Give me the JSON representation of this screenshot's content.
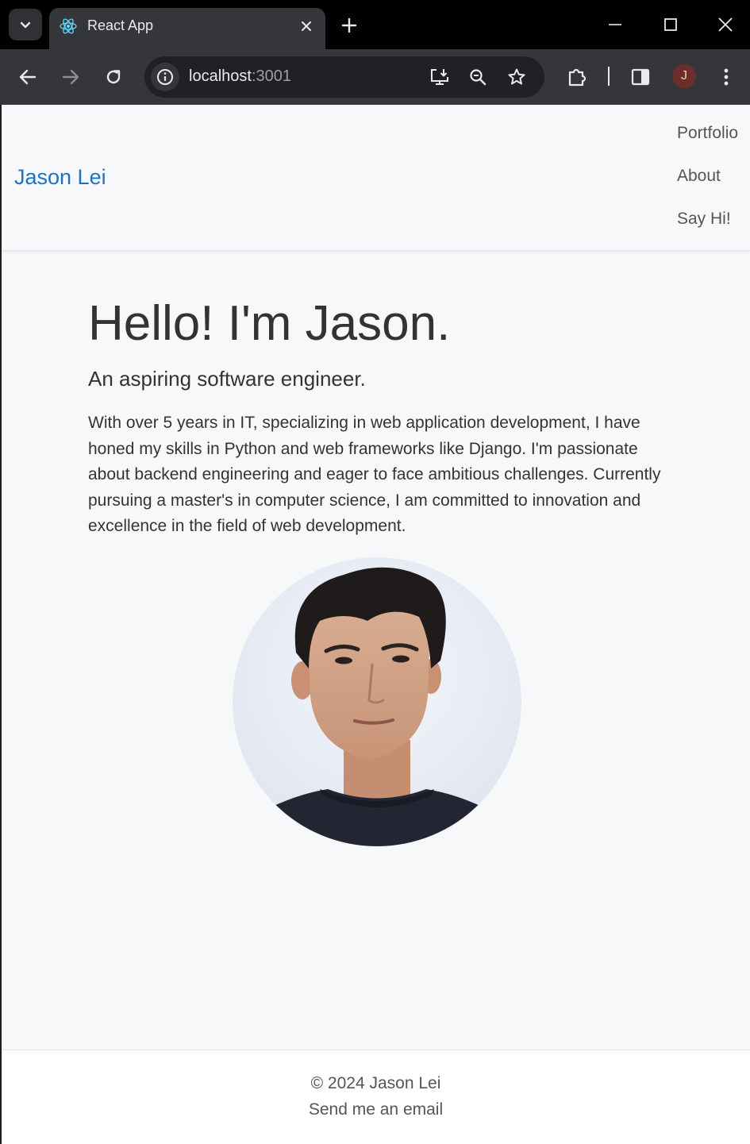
{
  "browser": {
    "tab_title": "React App",
    "url_host": "localhost",
    "url_port": ":3001",
    "profile_initial": "J",
    "icons": [
      "tab-search-icon",
      "react-favicon-icon",
      "close-icon",
      "plus-icon",
      "minimize-icon",
      "maximize-icon",
      "window-close-icon",
      "back-arrow-icon",
      "forward-arrow-icon",
      "reload-icon",
      "site-info-icon",
      "install-app-icon",
      "zoom-icon",
      "bookmark-star-icon",
      "extensions-icon",
      "side-panel-icon",
      "more-menu-icon"
    ]
  },
  "navbar": {
    "brand": "Jason Lei",
    "links": [
      "Portfolio",
      "About",
      "Say Hi!"
    ]
  },
  "hero": {
    "title": "Hello! I'm Jason.",
    "subtitle": "An aspiring software engineer.",
    "bio": "With over 5 years in IT, specializing in web application development, I have honed my skills in Python and web frameworks like Django. I'm passionate about backend engineering and eager to face ambitious challenges. Currently pursuing a master's in computer science, I am committed to innovation and excellence in the field of web development."
  },
  "footer": {
    "copyright": "© 2024 Jason Lei",
    "email_link": "Send me an email"
  },
  "colors": {
    "brand_link": "#1a73c8",
    "page_bg": "#f7f8fa",
    "text": "#333333",
    "chrome_bg": "#35363a"
  }
}
